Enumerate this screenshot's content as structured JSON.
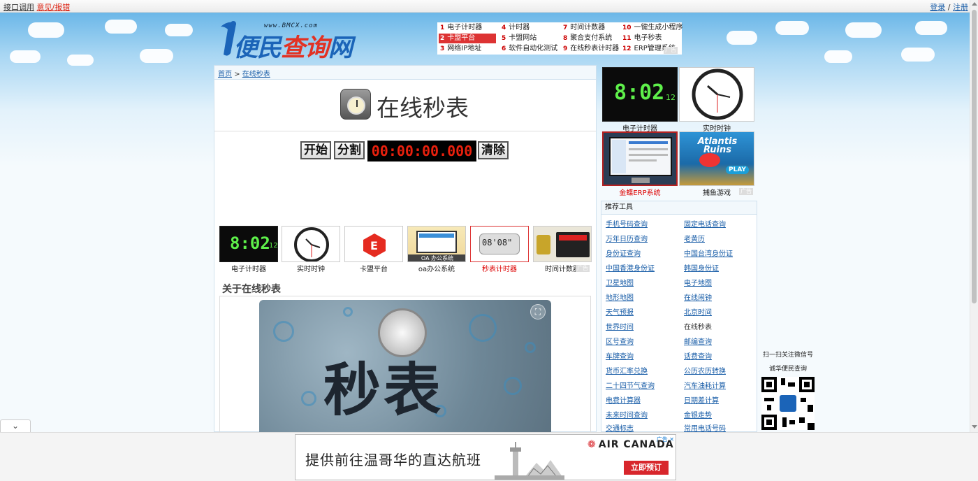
{
  "topbar": {
    "api_link": "接口调用",
    "feedback_link": "意见/报错",
    "login": "登录",
    "sep": "/",
    "register": "注册"
  },
  "logo": {
    "site": "www.BMCX.com",
    "name_a": "便民",
    "name_b": "查询",
    "name_c": "网"
  },
  "toplinks": [
    {
      "n": "1",
      "label": "电子计时器"
    },
    {
      "n": "2",
      "label": "卡盟平台"
    },
    {
      "n": "3",
      "label": "网络IP地址"
    },
    {
      "n": "4",
      "label": "计时器"
    },
    {
      "n": "5",
      "label": "卡盟网站"
    },
    {
      "n": "6",
      "label": "软件自动化测试"
    },
    {
      "n": "7",
      "label": "时间计数器"
    },
    {
      "n": "8",
      "label": "聚合支付系统"
    },
    {
      "n": "9",
      "label": "在线秒表计时器"
    },
    {
      "n": "10",
      "label": "一键生成小程序"
    },
    {
      "n": "11",
      "label": "电子秒表"
    },
    {
      "n": "12",
      "label": "ERP管理系统"
    }
  ],
  "ad_badge": "广告",
  "breadcrumb": {
    "home": "首页",
    "sep": ">",
    "current": "在线秒表"
  },
  "page_title": "在线秒表",
  "controls": {
    "start": "开始",
    "split": "分割",
    "timer": "00:00:00.000",
    "clear": "清除"
  },
  "thumbs": [
    {
      "label": "电子计时器",
      "digits": "8:02",
      "small": "12"
    },
    {
      "label": "实时时钟"
    },
    {
      "label": "卡盟平台"
    },
    {
      "label": "oa办公系统",
      "img_text": "OA 办公系统"
    },
    {
      "label": "秒表计时器",
      "digits": "08'08\""
    },
    {
      "label": "时间计数器"
    }
  ],
  "about_title": "关于在线秒表",
  "banner_text": "秒表",
  "side_thumbs": [
    {
      "label": "电子计时器",
      "digits": "8:02",
      "small": "12"
    },
    {
      "label": "实时时钟"
    },
    {
      "label": "金蝶ERP系统"
    },
    {
      "label": "捕鱼游戏",
      "img_text": "Atlantis Ruins",
      "play": "PLAY"
    }
  ],
  "tools": {
    "header": "推荐工具",
    "items": [
      "手机号码查询",
      "固定电话查询",
      "万年日历查询",
      "老黄历",
      "身份证查询",
      "中国台湾身份证",
      "中国香港身份证",
      "韩国身份证",
      "卫星地图",
      "电子地图",
      "地形地图",
      "在线闹钟",
      "天气预报",
      "北京时间",
      "世界时间",
      "在线秒表",
      "区号查询",
      "邮编查询",
      "车牌查询",
      "话费查询",
      "货币汇率兑换",
      "公历农历转换",
      "二十四节气查询",
      "汽车油耗计算",
      "电费计算器",
      "日期差计算",
      "未来时间查询",
      "金银走势",
      "交通标志",
      "常用电话号码"
    ]
  },
  "qr": {
    "line1": "扫一扫关注微信号",
    "line2": "诚华便民查询"
  },
  "ad": {
    "headline": "提供前往温哥华的直达航班",
    "brand": "AIR CANADA",
    "cta": "立即预订",
    "badge": "广告"
  }
}
